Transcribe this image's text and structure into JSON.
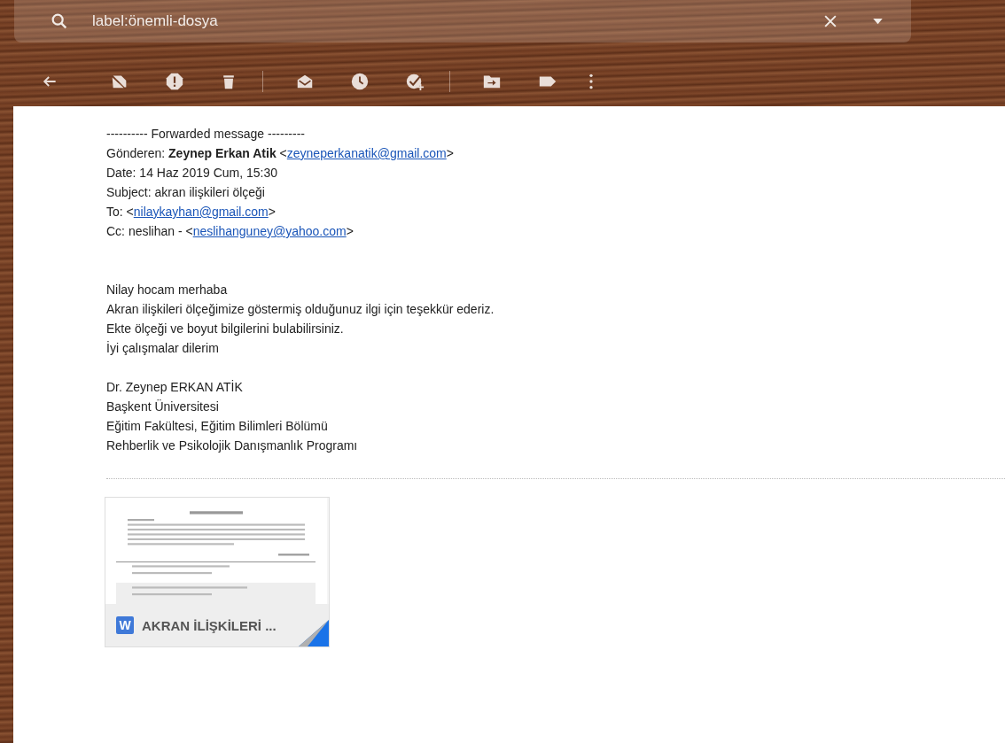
{
  "search": {
    "value": "label:önemli-dosya"
  },
  "message": {
    "forward_header": "---------- Forwarded message ---------",
    "header_lines": [
      [
        {
          "kind": "text",
          "text": "Gönderen: "
        },
        {
          "kind": "bold",
          "text": "Zeynep Erkan Atik"
        },
        {
          "kind": "text",
          "text": " <"
        },
        {
          "kind": "link",
          "text": "zeyneperkanatik@gmail.com"
        },
        {
          "kind": "text",
          "text": ">"
        }
      ],
      [
        {
          "kind": "text",
          "text": "Date: 14 Haz 2019 Cum, 15:30"
        }
      ],
      [
        {
          "kind": "text",
          "text": "Subject: akran ilişkileri ölçeği"
        }
      ],
      [
        {
          "kind": "text",
          "text": "To: <"
        },
        {
          "kind": "link",
          "text": "nilaykayhan@gmail.com"
        },
        {
          "kind": "text",
          "text": ">"
        }
      ],
      [
        {
          "kind": "text",
          "text": "Cc: neslihan - <"
        },
        {
          "kind": "link",
          "text": "neslihanguney@yahoo.com"
        },
        {
          "kind": "text",
          "text": ">"
        }
      ]
    ],
    "body": [
      "Nilay hocam merhaba",
      "Akran ilişkileri ölçeğimize göstermiş olduğunuz ilgi için teşekkür ederiz.",
      "Ekte ölçeği ve boyut bilgilerini bulabilirsiniz.",
      "İyi çalışmalar dilerim"
    ],
    "signature": [
      "Dr. Zeynep ERKAN ATİK",
      "Başkent Üniversitesi",
      "Eğitim Fakültesi, Eğitim Bilimleri Bölümü",
      "Rehberlik ve Psikolojik Danışmanlık Programı"
    ],
    "attachment": {
      "type_letter": "W",
      "name": "AKRAN İLİŞKİLERİ ..."
    }
  }
}
